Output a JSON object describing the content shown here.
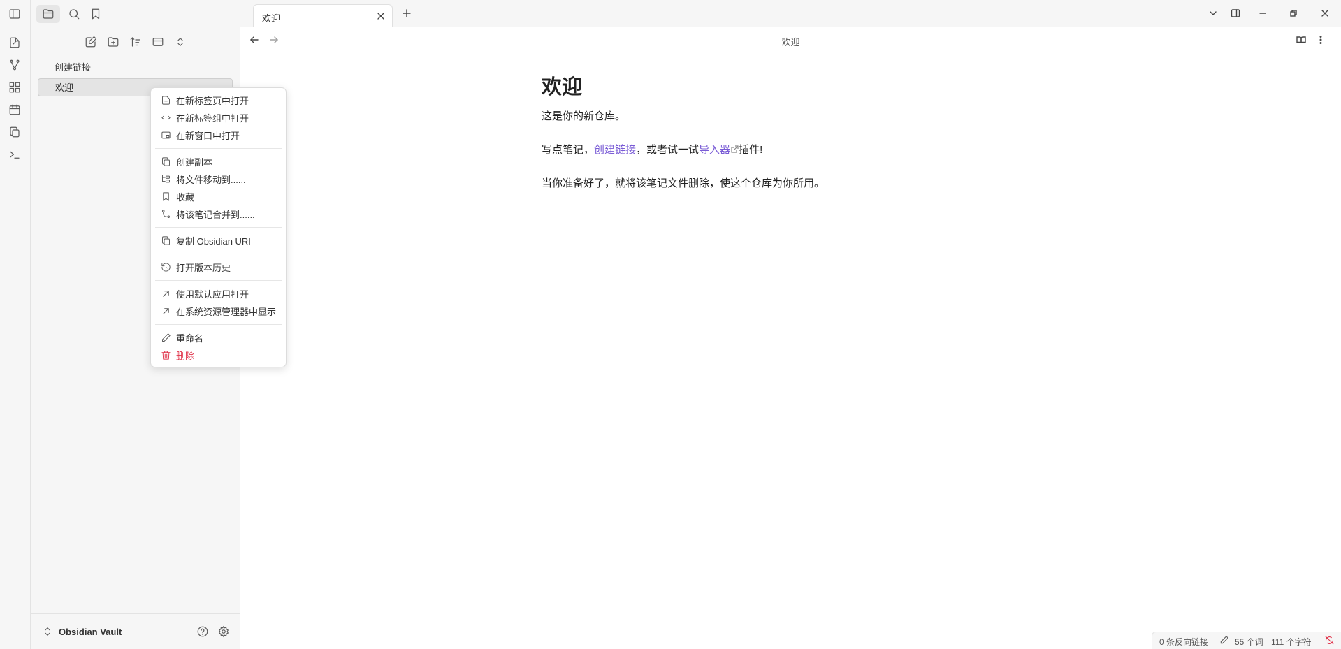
{
  "sidebar": {
    "files": [
      {
        "label": "创建链接"
      },
      {
        "label": "欢迎"
      }
    ],
    "vault_name": "Obsidian Vault"
  },
  "tab": {
    "label": "欢迎"
  },
  "view": {
    "title": "欢迎"
  },
  "note": {
    "heading": "欢迎",
    "p1": "这是你的新仓库。",
    "p2_before": "写点笔记，",
    "p2_link1": "创建链接",
    "p2_middle": "，或者试一试",
    "p2_link2": "导入器",
    "p2_after": "插件!",
    "p3": "当你准备好了，就将该笔记文件删除，使这个仓库为你所用。"
  },
  "context_menu": {
    "open_new_tab": "在新标签页中打开",
    "open_new_group": "在新标签组中打开",
    "open_new_window": "在新窗口中打开",
    "make_copy": "创建副本",
    "move_file": "将文件移动到......",
    "bookmark": "收藏",
    "merge_note": "将该笔记合并到......",
    "copy_uri": "复制 Obsidian URI",
    "version_history": "打开版本历史",
    "open_default_app": "使用默认应用打开",
    "show_in_explorer": "在系统资源管理器中显示",
    "rename": "重命名",
    "delete": "删除"
  },
  "statusbar": {
    "backlinks": "0 条反向链接",
    "words": "55 个词",
    "chars": "111 个字符"
  },
  "colors": {
    "accent": "#7a5cd6",
    "danger": "#e0334a"
  }
}
